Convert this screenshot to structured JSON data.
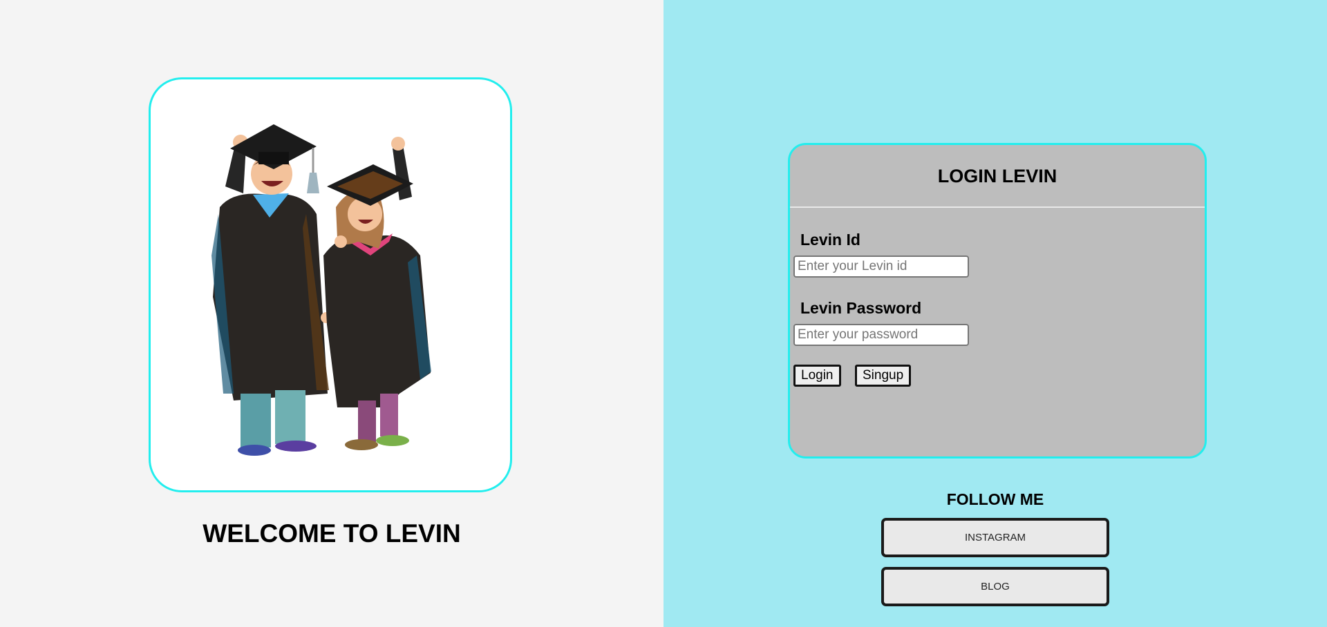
{
  "welcome": {
    "title": "WELCOME TO LEVIN",
    "illustration": "graduates-illustration"
  },
  "login": {
    "title": "LOGIN LEVIN",
    "id_label": "Levin Id",
    "id_placeholder": "Enter your Levin id",
    "id_value": "",
    "password_label": "Levin Password",
    "password_placeholder": "Enter your password",
    "password_value": "",
    "login_button": "Login",
    "signup_button": "Singup"
  },
  "follow": {
    "title": "FOLLOW ME",
    "links": [
      "INSTAGRAM",
      "BLOG"
    ]
  },
  "colors": {
    "left_background": "#f4f4f4",
    "right_background": "#a0e9f2",
    "card_border": "#22eeee",
    "login_card_background": "#bdbdbd"
  }
}
